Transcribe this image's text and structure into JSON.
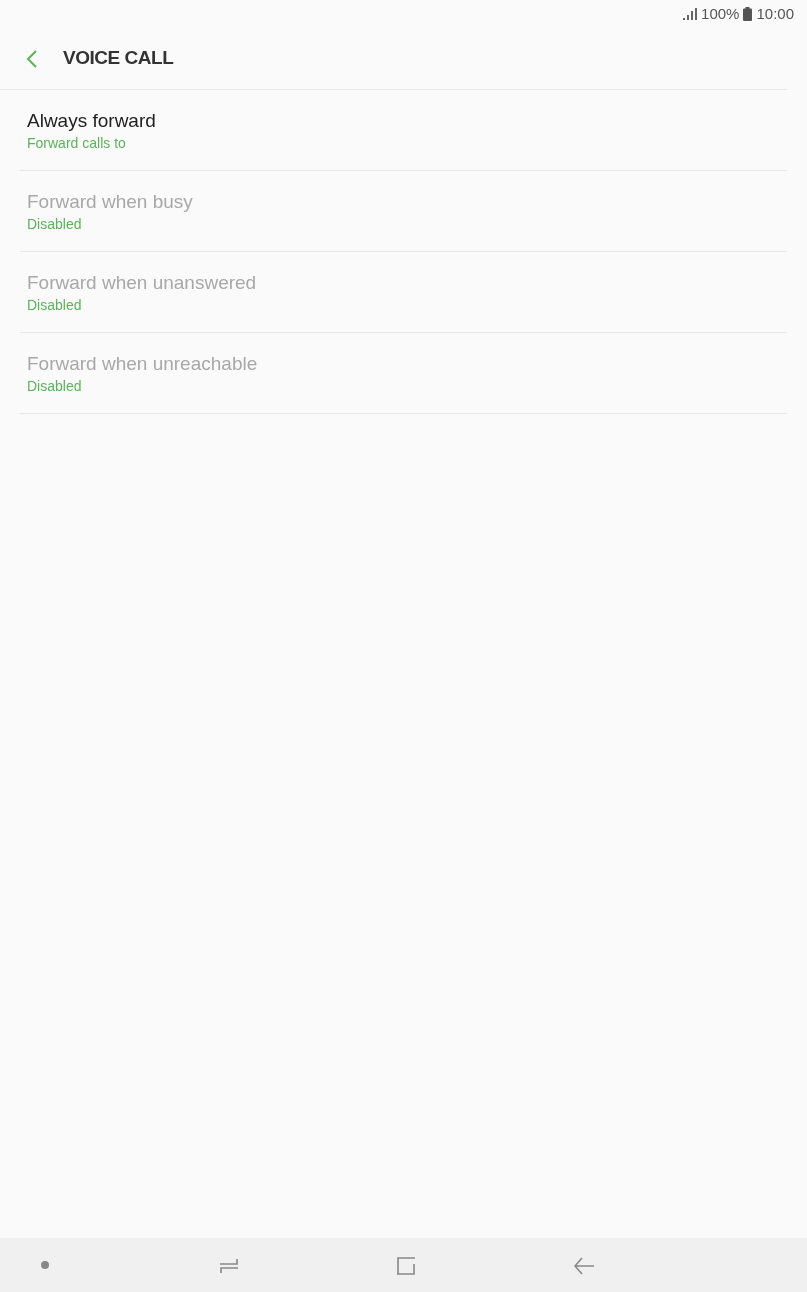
{
  "status_bar": {
    "battery": "100%",
    "time": "10:00"
  },
  "header": {
    "title": "VOICE CALL"
  },
  "items": [
    {
      "title": "Always forward",
      "subtitle": "Forward calls to",
      "disabled": false
    },
    {
      "title": "Forward when busy",
      "subtitle": "Disabled",
      "disabled": true
    },
    {
      "title": "Forward when unanswered",
      "subtitle": "Disabled",
      "disabled": true
    },
    {
      "title": "Forward when unreachable",
      "subtitle": "Disabled",
      "disabled": true
    }
  ]
}
